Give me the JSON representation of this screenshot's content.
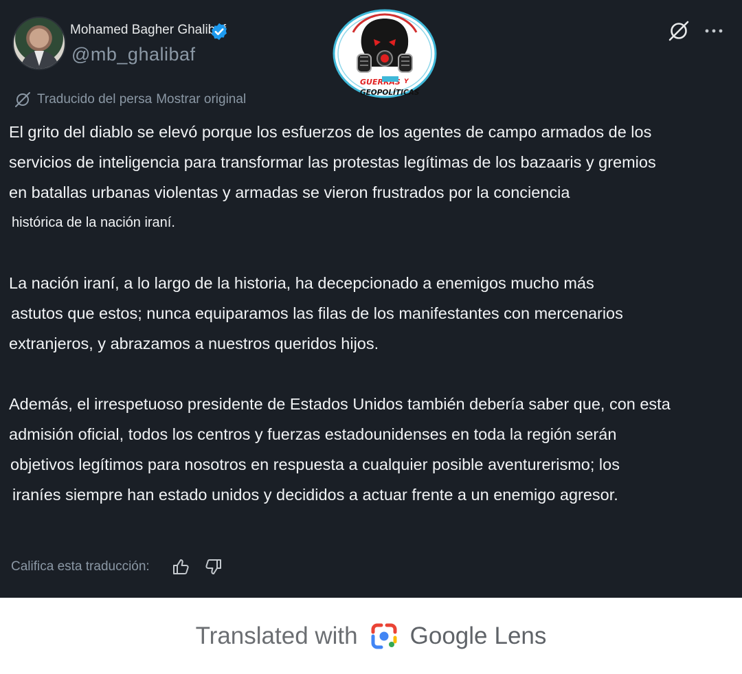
{
  "post": {
    "author_name": "Mohamed Bagher Ghalibaf",
    "handle": "@mb_ghalibaf",
    "translation_notice": "Traducido del persa",
    "show_original_label": "Mostrar original",
    "paragraphs": [
      {
        "lines": [
          "El grito del diablo se elevó porque los esfuerzos de los agentes de campo armados de los",
          "servicios de inteligencia para transformar las protestas legítimas de los bazaaris y gremios",
          "en batallas urbanas violentas y armadas se vieron frustrados por la conciencia",
          "histórica de la nación iraní."
        ]
      },
      {
        "lines": [
          "La nación iraní, a lo largo de la historia, ha decepcionado a enemigos mucho más",
          "astutos que estos; nunca equiparamos las filas de los manifestantes con mercenarios",
          "extranjeros, y abrazamos a nuestros queridos hijos."
        ]
      },
      {
        "lines": [
          "Además, el irrespetuoso presidente de Estados Unidos también debería saber que, con esta",
          "admisión oficial, todos los centros y fuerzas estadounidenses en toda la región serán",
          "objetivos legítimos para nosotros en respuesta a cualquier posible aventurerismo; los",
          "iraníes siempre han estado unidos y decididos a actuar frente a un enemigo agresor."
        ]
      }
    ],
    "rate_translation_label": "Califica esta traducción:"
  },
  "watermark": {
    "line1": "GUERRAS",
    "line2": "Y",
    "line3": "GEOPOLÍTICAS"
  },
  "footer": {
    "prefix": "Translated with",
    "brand_google": "Google",
    "brand_lens": "Lens"
  },
  "icons": {
    "verified": "verified-badge-icon",
    "grok": "grok-icon",
    "more": "more-options-icon",
    "translate": "translate-icon",
    "thumbs_up": "thumbs-up-icon",
    "thumbs_down": "thumbs-down-icon",
    "lens": "google-lens-icon"
  },
  "colors": {
    "background": "#1a1f26",
    "verified": "#1d9bf0",
    "muted_text": "#8b98a5",
    "body_text": "#f1f3f5"
  }
}
